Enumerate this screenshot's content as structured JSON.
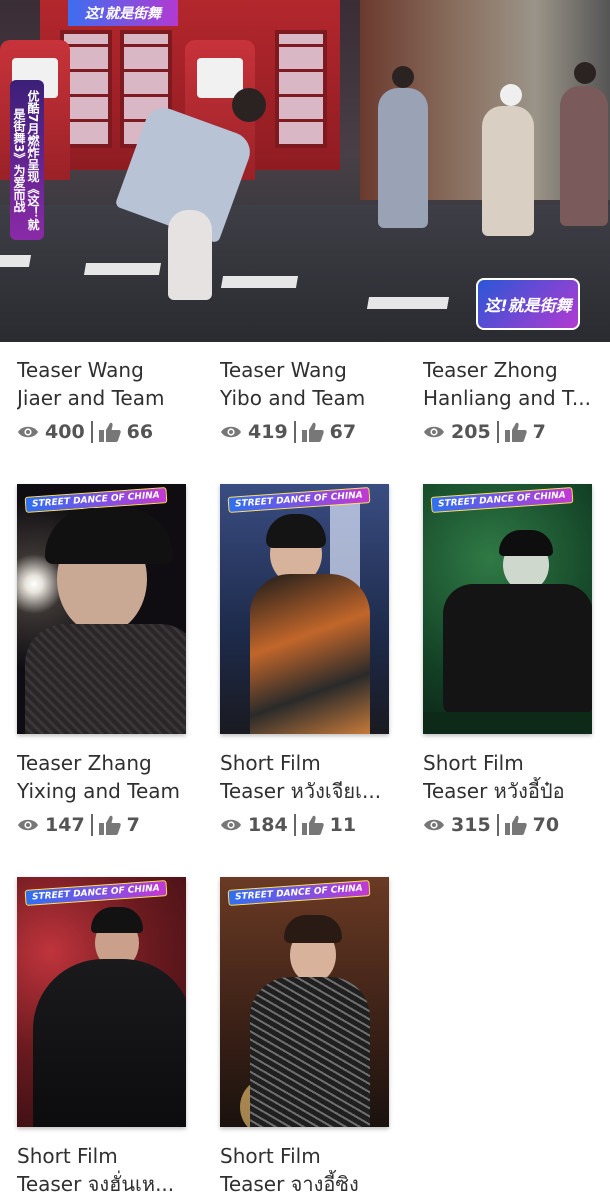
{
  "hero": {
    "side_banner": "优酷7月燃炸呈现《这！就是街舞3》为爱而战",
    "logo": "这!就是街舞",
    "top_logo": "这!就是街舞"
  },
  "cards": [
    {
      "title_line1": "Teaser Wang",
      "title_line2": "Jiaer and Team",
      "views": "400",
      "likes": "66",
      "thumb": "hero"
    },
    {
      "title_line1": "Teaser Wang",
      "title_line2": "Yibo and Team",
      "views": "419",
      "likes": "67",
      "thumb": "hero"
    },
    {
      "title_line1": "Teaser Zhong",
      "title_line2": "Hanliang and T...",
      "views": "205",
      "likes": "7",
      "thumb": "hero"
    },
    {
      "title_line1": "Teaser Zhang",
      "title_line2": "Yixing and Team",
      "views": "147",
      "likes": "7",
      "badge": "STREET DANCE OF CHINA",
      "bg": "#0f0d12",
      "accent": "#f2efe6"
    },
    {
      "title_line1": "Short Film",
      "title_line2": "Teaser หวังเจียเ...",
      "views": "184",
      "likes": "11",
      "badge": "STREET DANCE OF CHINA",
      "bg": "#2a3b66",
      "accent": "#d8772a"
    },
    {
      "title_line1": "Short Film",
      "title_line2": "Teaser หวังอี้ป๋อ",
      "views": "315",
      "likes": "70",
      "badge": "STREET DANCE OF CHINA",
      "bg": "#123c2a",
      "accent": "#3fae5a"
    },
    {
      "title_line1": "Short Film",
      "title_line2": "Teaser จงฮั่นเห...",
      "views": "",
      "likes": "",
      "badge": "STREET DANCE OF CHINA",
      "bg": "#3a1216",
      "accent": "#b3262f"
    },
    {
      "title_line1": "Short Film",
      "title_line2": "Teaser จางอี้ซิง",
      "views": "",
      "likes": "",
      "badge": "STREET DANCE OF CHINA",
      "bg": "#4a2a1c",
      "accent": "#c8823a"
    }
  ],
  "icons": {
    "views": "eye-icon",
    "likes": "thumbs-up-icon"
  },
  "colors": {
    "text": "#303030",
    "meta": "#555555",
    "badge_start": "#2f6ff2",
    "badge_end": "#c338d4"
  }
}
